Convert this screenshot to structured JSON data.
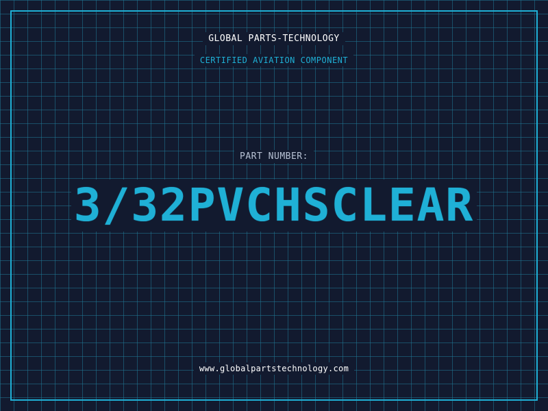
{
  "header": {
    "company": "GLOBAL PARTS-TECHNOLOGY",
    "subtitle": "CERTIFIED AVIATION COMPONENT"
  },
  "part": {
    "label": "PART NUMBER:",
    "number": "3/32PVCHSCLEAR"
  },
  "footer": {
    "website": "www.globalpartstechnology.com"
  },
  "colors": {
    "background": "#121a2f",
    "grid": "#20788f",
    "accent": "#1fb0d6",
    "text": "#ffffff",
    "muted": "#b8c2d4"
  }
}
